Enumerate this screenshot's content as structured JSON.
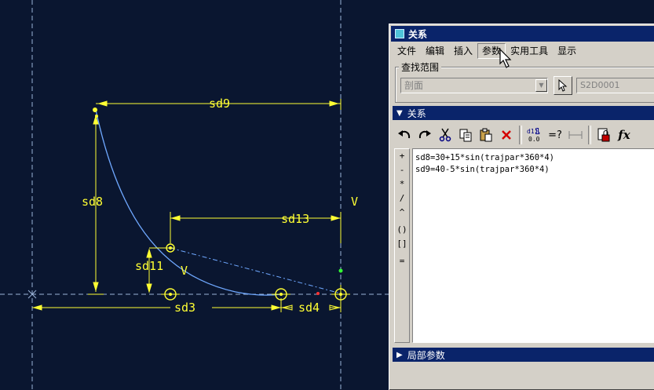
{
  "sketch": {
    "dims": [
      "sd9",
      "sd8",
      "sd13",
      "sd11",
      "sd3",
      "sd4"
    ],
    "vertical_marks": [
      "V",
      "V"
    ]
  },
  "dialog": {
    "title": "关系",
    "menu": [
      "文件",
      "编辑",
      "插入",
      "参数",
      "实用工具",
      "显示"
    ],
    "pressed_menu": "参数",
    "search": {
      "label": "查找范围",
      "combo_value": "剖面",
      "reference": "S2D0001"
    },
    "relations": {
      "header": "关系",
      "lines": [
        "sd8=30+15*sin(trajpar*360*4)",
        "sd9=40-5*sin(trajpar*360*4)"
      ]
    },
    "side_ops": [
      "+",
      "-",
      "*",
      "/",
      "^",
      "()",
      "[]",
      "="
    ],
    "local_params": "局部参数",
    "fx_label": "fx"
  }
}
